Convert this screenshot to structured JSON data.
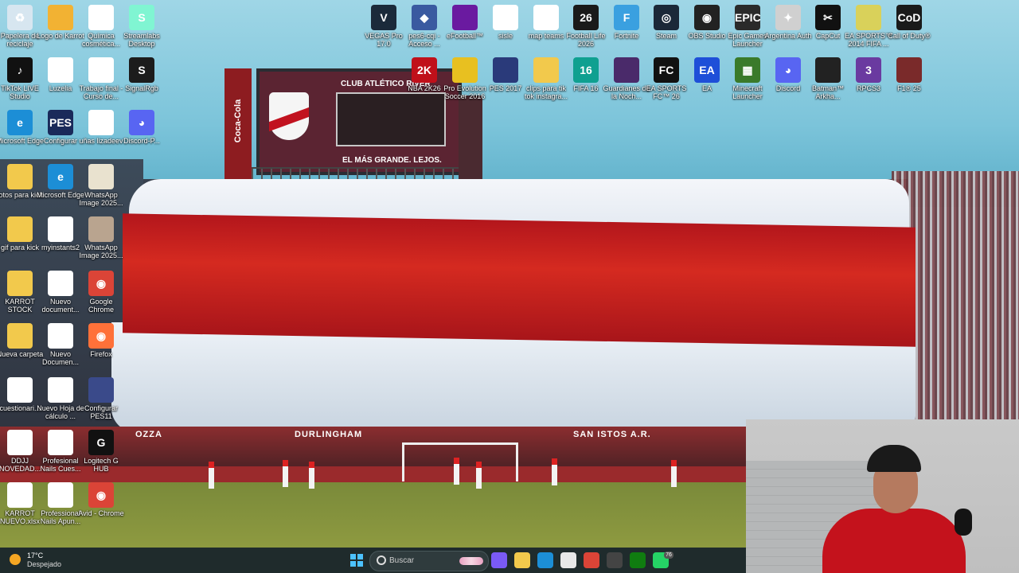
{
  "desktop_icons": [
    {
      "label": "Papelera de reciclaje",
      "color": "#d7e6f0",
      "sym": "♻"
    },
    {
      "label": "Logo de Karrot",
      "color": "#f2b233",
      "sym": ""
    },
    {
      "label": "Química cosmética...",
      "color": "#ffffff",
      "sym": ""
    },
    {
      "label": "Streamlabs Desktop",
      "color": "#80f5d2",
      "sym": "S"
    },
    {
      "label": "TikTok LIVE Studio",
      "color": "#111111",
      "sym": "♪"
    },
    {
      "label": "Luzelia",
      "color": "#ffffff",
      "sym": ""
    },
    {
      "label": "Trabajo final - Curso de...",
      "color": "#ffffff",
      "sym": ""
    },
    {
      "label": "SignalRgb",
      "color": "#1c1c1c",
      "sym": "S"
    },
    {
      "label": "Microsoft Edge",
      "color": "#1c8ed6",
      "sym": "e"
    },
    {
      "label": "Configurar",
      "color": "#1a2a5a",
      "sym": "PES"
    },
    {
      "label": "uñas lizadeev",
      "color": "#ffffff",
      "sym": ""
    },
    {
      "label": "Discord-P...",
      "color": "#5865f2",
      "sym": "◕"
    },
    {
      "label": "fotos para kick",
      "color": "#f2c94c",
      "sym": ""
    },
    {
      "label": "Microsoft Edge",
      "color": "#1c8ed6",
      "sym": "e"
    },
    {
      "label": "WhatsApp Image 2025...",
      "color": "#e9e2cf",
      "sym": ""
    },
    {
      "label": "gif para kick",
      "color": "#f2c94c",
      "sym": ""
    },
    {
      "label": "myinstants2",
      "color": "#ffffff",
      "sym": "▶"
    },
    {
      "label": "WhatsApp Image 2025...",
      "color": "#b9a48f",
      "sym": ""
    },
    {
      "label": "KARROT STOCK",
      "color": "#f2c94c",
      "sym": ""
    },
    {
      "label": "Nuevo document...",
      "color": "#ffffff",
      "sym": ""
    },
    {
      "label": "Google Chrome",
      "color": "#db4437",
      "sym": "◉"
    },
    {
      "label": "Nueva carpeta",
      "color": "#f2c94c",
      "sym": ""
    },
    {
      "label": "Nuevo Documen...",
      "color": "#ffffff",
      "sym": ""
    },
    {
      "label": "Firefox",
      "color": "#ff7139",
      "sym": "◉"
    },
    {
      "label": "cuestionari...",
      "color": "#ffffff",
      "sym": ""
    },
    {
      "label": "Nuevo Hoja de cálculo ...",
      "color": "#ffffff",
      "sym": ""
    },
    {
      "label": "Configurar PES11",
      "color": "#3a4a8a",
      "sym": ""
    },
    {
      "label": "DDJJ NOVEDAD...",
      "color": "#ffffff",
      "sym": ""
    },
    {
      "label": "Profesional Nails Cues...",
      "color": "#ffffff",
      "sym": ""
    },
    {
      "label": "Logitech G HUB",
      "color": "#111111",
      "sym": "G"
    },
    {
      "label": "KARROT NUEVO.xlsx",
      "color": "#ffffff",
      "sym": ""
    },
    {
      "label": "Professional Nails Apun...",
      "color": "#ffffff",
      "sym": ""
    },
    {
      "label": "Avid - Chrome",
      "color": "#db4437",
      "sym": "◉"
    },
    {
      "label": "VEGAS Pro 17.0",
      "color": "#1b2a3a",
      "sym": "V"
    },
    {
      "label": "pes6-cqi - Acceso ...",
      "color": "#3a5aa0",
      "sym": "◆"
    },
    {
      "label": "eFootball™",
      "color": "#6a1aa0",
      "sym": ""
    },
    {
      "label": "sisle",
      "color": "#ffffff",
      "sym": ""
    },
    {
      "label": "map teams",
      "color": "#ffffff",
      "sym": ""
    },
    {
      "label": "Football Life 2026",
      "color": "#1a1a1a",
      "sym": "26"
    },
    {
      "label": "Fortnite",
      "color": "#3aa0e0",
      "sym": "F"
    },
    {
      "label": "Steam",
      "color": "#1b2838",
      "sym": "◎"
    },
    {
      "label": "OBS Studio",
      "color": "#222222",
      "sym": "◉"
    },
    {
      "label": "Epic Games Launcher",
      "color": "#2a2a2a",
      "sym": "EPIC"
    },
    {
      "label": "Argentina Auth",
      "color": "#d0d0d0",
      "sym": "✦"
    },
    {
      "label": "CapCut",
      "color": "#111111",
      "sym": "✂"
    },
    {
      "label": "EA SPORTS™ 2014 FIFA ...",
      "color": "#d9d15a",
      "sym": ""
    },
    {
      "label": "Call of Duty®",
      "color": "#1a1a1a",
      "sym": "CoD"
    },
    {
      "label": "NBA 2K26",
      "color": "#c0101a",
      "sym": "2K"
    },
    {
      "label": "Pro Evolution Soccer 2016",
      "color": "#e8c020",
      "sym": ""
    },
    {
      "label": "PES 2017",
      "color": "#2a3a7a",
      "sym": ""
    },
    {
      "label": "clips para tik tok instagra...",
      "color": "#f2c94c",
      "sym": ""
    },
    {
      "label": "FIFA 16",
      "color": "#0fa090",
      "sym": "16"
    },
    {
      "label": "Guardianes de la Noch...",
      "color": "#4a2a6a",
      "sym": ""
    },
    {
      "label": "EA SPORTS FC™ 26",
      "color": "#111111",
      "sym": "FC"
    },
    {
      "label": "EA",
      "color": "#1e4fd8",
      "sym": "EA"
    },
    {
      "label": "Minecraft Launcher",
      "color": "#3a7a2a",
      "sym": "▦"
    },
    {
      "label": "Discord",
      "color": "#5865f2",
      "sym": "◕"
    },
    {
      "label": "Batman™ Arkha...",
      "color": "#222222",
      "sym": ""
    },
    {
      "label": "RPCS3",
      "color": "#6a3aa0",
      "sym": "3"
    },
    {
      "label": "F1® 25",
      "color": "#7a2a2a",
      "sym": ""
    }
  ],
  "wallpaper": {
    "scoreboard_title": "CLUB ATLÉTICO RIVER",
    "scoreboard_slogan": "EL MÁS GRANDE. LEJOS.",
    "pillar_text": "Coca-Cola",
    "banners": [
      "OZZA",
      "DURLINGHAM",
      "SAN ISTOS A.R."
    ]
  },
  "taskbar": {
    "weather_temp": "17°C",
    "weather_desc": "Despejado",
    "search_placeholder": "Buscar",
    "badge_count": "76",
    "apps": [
      {
        "name": "copilot-icon",
        "color": "#7a5af5"
      },
      {
        "name": "file-explorer-icon",
        "color": "#f2c94c"
      },
      {
        "name": "edge-icon",
        "color": "#1c8ed6"
      },
      {
        "name": "store-icon",
        "color": "#e8e8e8"
      },
      {
        "name": "chrome-icon",
        "color": "#db4437"
      },
      {
        "name": "media-icon",
        "color": "#444444"
      },
      {
        "name": "xbox-icon",
        "color": "#107c10"
      },
      {
        "name": "whatsapp-icon",
        "color": "#25d366"
      }
    ]
  }
}
